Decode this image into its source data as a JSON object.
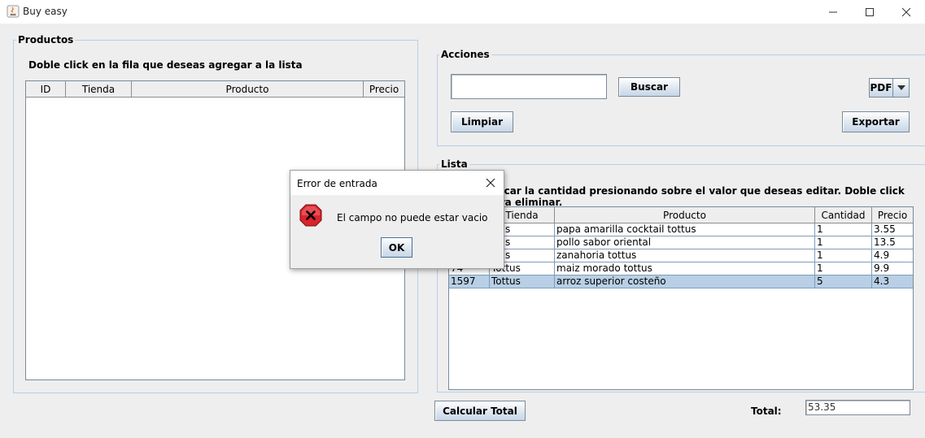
{
  "window": {
    "title": "Buy easy"
  },
  "productos": {
    "group_title": "Productos",
    "instruction": "Doble click en la fila que deseas agregar a la lista",
    "columns": [
      "ID",
      "Tienda",
      "Producto",
      "Precio"
    ]
  },
  "acciones": {
    "group_title": "Acciones",
    "search_value": "",
    "buscar_label": "Buscar",
    "limpiar_label": "Limpiar",
    "format_selected": "PDF",
    "exportar_label": "Exportar"
  },
  "lista": {
    "group_title": "Lista",
    "instruction": "dificar la cantidad presionando sobre el valor que deseas editar. Doble click para eliminar.",
    "columns": [
      "ID",
      "Tienda",
      "Producto",
      "Cantidad",
      "Precio"
    ],
    "rows": [
      {
        "id": "",
        "tienda": "ttus",
        "producto": "papa amarilla cocktail tottus",
        "cantidad": "1",
        "precio": "3.55",
        "selected": false
      },
      {
        "id": "",
        "tienda": "ttus",
        "producto": "pollo sabor oriental",
        "cantidad": "1",
        "precio": "13.5",
        "selected": false
      },
      {
        "id": "",
        "tienda": "ttus",
        "producto": "zanahoria tottus",
        "cantidad": "1",
        "precio": "4.9",
        "selected": false
      },
      {
        "id": "74",
        "tienda": "Tottus",
        "producto": "maiz morado tottus",
        "cantidad": "1",
        "precio": "9.9",
        "selected": false
      },
      {
        "id": "1597",
        "tienda": "Tottus",
        "producto": "arroz superior costeño",
        "cantidad": "5",
        "precio": "4.3",
        "selected": true
      }
    ]
  },
  "footer": {
    "calcular_label": "Calcular Total",
    "total_label": "Total:",
    "total_value": "53.35"
  },
  "dialog": {
    "title": "Error de entrada",
    "message": "El campo no puede estar vacio",
    "ok_label": "OK",
    "icon": "error-icon"
  },
  "colors": {
    "selection": "#b8cfe5",
    "border_blue": "#b8cfe5",
    "error_red": "#d9242b"
  }
}
